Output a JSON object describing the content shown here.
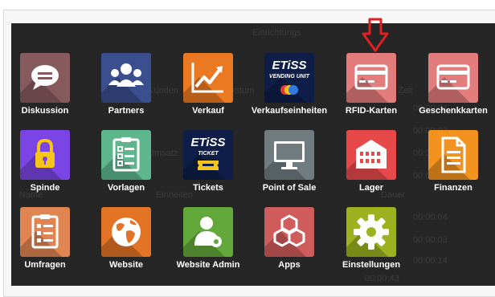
{
  "background_text": [
    "Einrichtungs",
    "Kunden",
    "Datum",
    "Umsatz",
    "Einheiten",
    "Name",
    "Start Zeit",
    "00:00:04",
    "Dauer",
    "00:00:03",
    "00:00:03",
    "00:00:04",
    "00:00:04",
    "00:00:03",
    "00:00:14",
    "00:00:43"
  ],
  "apps": [
    {
      "label": "Diskussion",
      "icon": "chat-bubble-icon",
      "color": "#875A5E"
    },
    {
      "label": "Partners",
      "icon": "users-group-icon",
      "color": "#3B4F8F"
    },
    {
      "label": "Verkauf",
      "icon": "trend-chart-icon",
      "color": "#EB7922"
    },
    {
      "label": "Verkaufseinheiten",
      "icon": "etiss-vending-unit-logo",
      "color": "#0F1E48",
      "logo_title": "ETiSS",
      "logo_subtitle": "VENDING UNIT"
    },
    {
      "label": "RFID-Karten",
      "icon": "credit-card-icon",
      "color": "#E37C7C"
    },
    {
      "label": "Geschenkkarten",
      "icon": "gift-card-icon",
      "color": "#E37C7C"
    },
    {
      "label": "Spinde",
      "icon": "padlock-icon",
      "color": "#7B44E5"
    },
    {
      "label": "Vorlagen",
      "icon": "checklist-clipboard-icon",
      "color": "#5EB68D"
    },
    {
      "label": "Tickets",
      "icon": "etiss-ticket-logo",
      "color": "#0F1E48",
      "logo_title": "ETiSS",
      "logo_subtitle": "TICKET"
    },
    {
      "label": "Point of Sale",
      "icon": "monitor-icon",
      "color": "#707C7F"
    },
    {
      "label": "Lager",
      "icon": "warehouse-building-icon",
      "color": "#E7494B"
    },
    {
      "label": "Finanzen",
      "icon": "invoice-document-icon",
      "color": "#F2931F"
    },
    {
      "label": "Umfragen",
      "icon": "survey-clipboard-icon",
      "color": "#E08451"
    },
    {
      "label": "Website",
      "icon": "globe-icon",
      "color": "#E37426"
    },
    {
      "label": "Website Admin",
      "icon": "user-gear-icon",
      "color": "#63A83A"
    },
    {
      "label": "Apps",
      "icon": "cubes-icon",
      "color": "#D15C5C"
    },
    {
      "label": "Einstellungen",
      "icon": "gear-icon",
      "color": "#9CB21E"
    }
  ],
  "annotation": {
    "icon": "down-arrow-icon",
    "color": "#E02020"
  }
}
